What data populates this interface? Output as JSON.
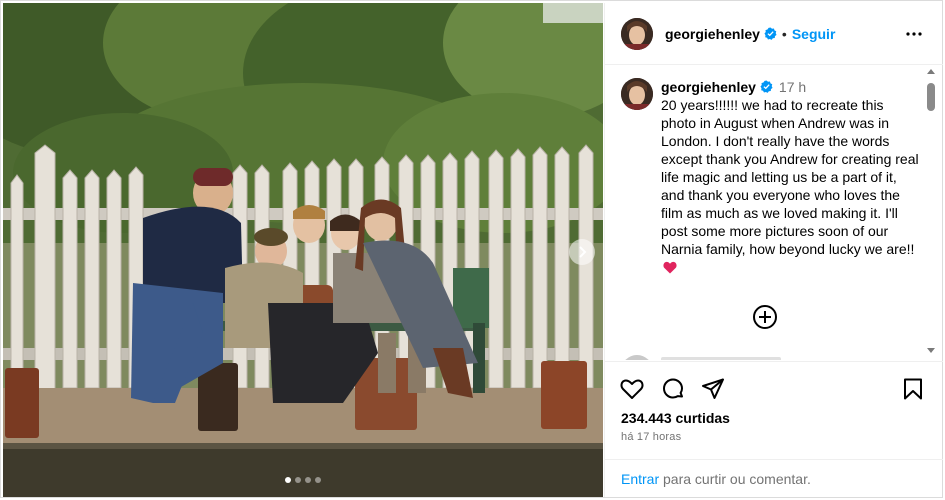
{
  "post": {
    "username": "georgiehenley",
    "follow_label": "Seguir",
    "separator": "•",
    "time_ago_short": "17 h",
    "caption": "20 years!!!!!! we had to recreate this photo in August when Andrew was in London. I don't really have the words except thank you Andrew for creating real life magic and letting us be a part of it, and thank you everyone who loves the film as much as we loved making it. I'll post some more pictures soon of our Narnia family, how beyond lucky we are!!",
    "caption_emoji": "red-heart-icon",
    "likes": "234.443 curtidas",
    "time_ago_long": "há 17 horas",
    "login_link": "Entrar",
    "login_text": " para curtir ou comentar."
  },
  "carousel": {
    "slides": 4,
    "active_slide": 1
  },
  "icons": {
    "more": "more-options-icon",
    "verified": "verified-badge-icon",
    "load_more": "plus-circle-icon",
    "like": "heart-icon",
    "comment": "comment-icon",
    "share": "share-icon",
    "save": "bookmark-icon",
    "next": "chevron-right-icon"
  },
  "colors": {
    "accent": "#0095f6",
    "verified": "#0095f6",
    "muted": "#737373",
    "heart": "#e0245e"
  }
}
